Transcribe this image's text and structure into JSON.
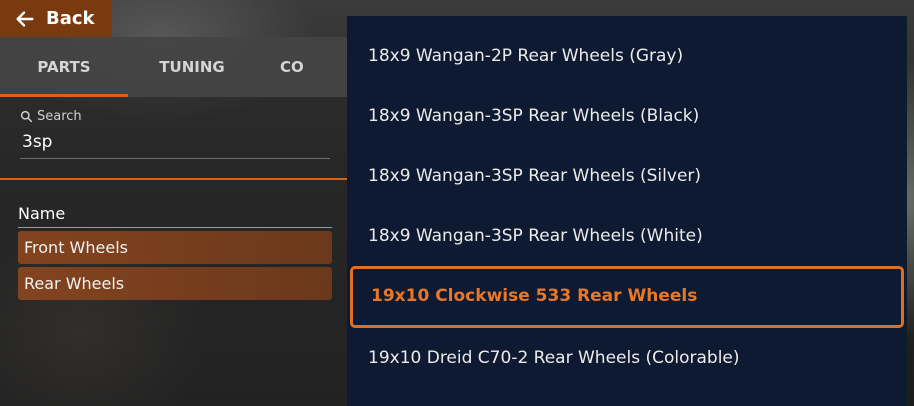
{
  "back_button": {
    "label": "Back",
    "icon": "arrow-left-icon"
  },
  "tabs": [
    {
      "label": "PARTS",
      "active": true
    },
    {
      "label": "TUNING",
      "active": false
    },
    {
      "label": "CO",
      "active": false
    }
  ],
  "search": {
    "label": "Search",
    "value": "3sp",
    "icon": "search-icon"
  },
  "parts_list": {
    "column_header": "Name",
    "rows": [
      {
        "label": "Front Wheels"
      },
      {
        "label": "Rear Wheels"
      }
    ]
  },
  "dropdown": {
    "items": [
      {
        "label": "18x9 Wangan-2P Rear Wheels (Gray)"
      },
      {
        "label": "18x9 Wangan-3SP Rear Wheels (Black)"
      },
      {
        "label": "18x9 Wangan-3SP Rear Wheels (Silver)"
      },
      {
        "label": "18x9 Wangan-3SP Rear Wheels (White)"
      },
      {
        "label": "19x10 Clockwise 533 Rear Wheels",
        "selected": true
      },
      {
        "label": "19x10 Dreid C70-2 Rear Wheels (Colorable)"
      }
    ]
  },
  "colors": {
    "accent": "#e07020",
    "dropdown_bg": "#0e1a31",
    "back_button_bg": "#7a3a10"
  }
}
